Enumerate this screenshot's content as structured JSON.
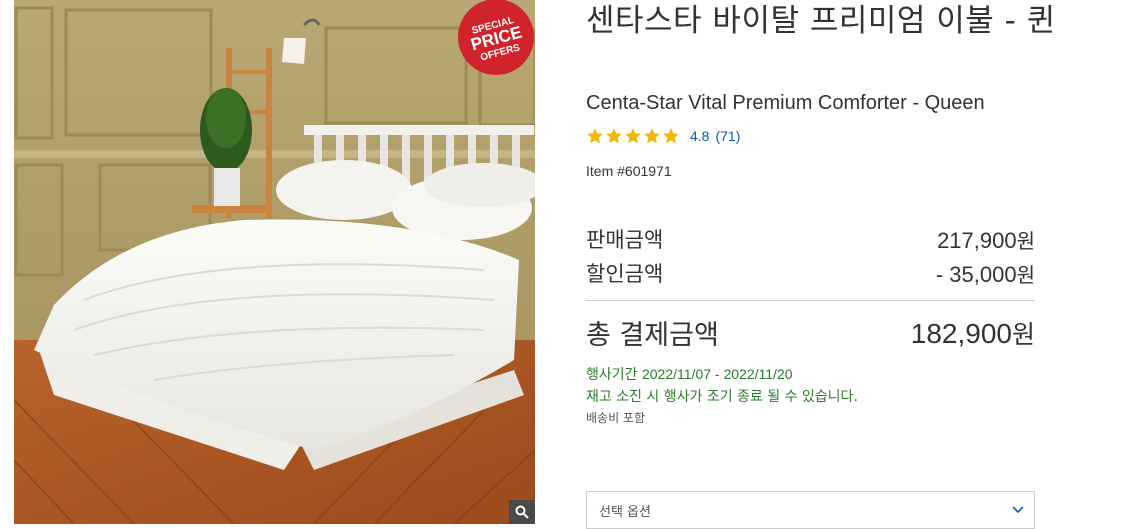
{
  "product": {
    "title_ko": "센타스타 바이탈 프리미엄 이불 - 퀸",
    "title_en": "Centa-Star Vital Premium Comforter - Queen",
    "rating": {
      "value": "4.8",
      "count": "(71)",
      "stars": 4.8
    },
    "item_number": "Item #601971"
  },
  "badge": {
    "line1": "SPECIAL",
    "line2": "PRICE",
    "line3": "OFFERS",
    "color": "#d0232b"
  },
  "pricing": {
    "sale_label": "판매금액",
    "sale_value": "217,900",
    "discount_label": "할인금액",
    "discount_value": "- 35,000",
    "total_label": "총 결제금액",
    "total_value": "182,900",
    "currency": "원"
  },
  "promotion": {
    "period_label": "행사기간",
    "period_dates": "2022/11/07 - 2022/11/20",
    "notice": "재고 소진 시 행사가 조기 종료 될 수 있습니다.",
    "shipping": "배송비 포함",
    "color": "#2b7d2b"
  },
  "options": {
    "placeholder": "선택 옵션"
  },
  "icons": {
    "zoom": "magnifier-icon",
    "dropdown": "chevron-down-icon",
    "star": "star-icon"
  },
  "colors": {
    "link": "#0a5ba8",
    "star": "#f2b705"
  }
}
